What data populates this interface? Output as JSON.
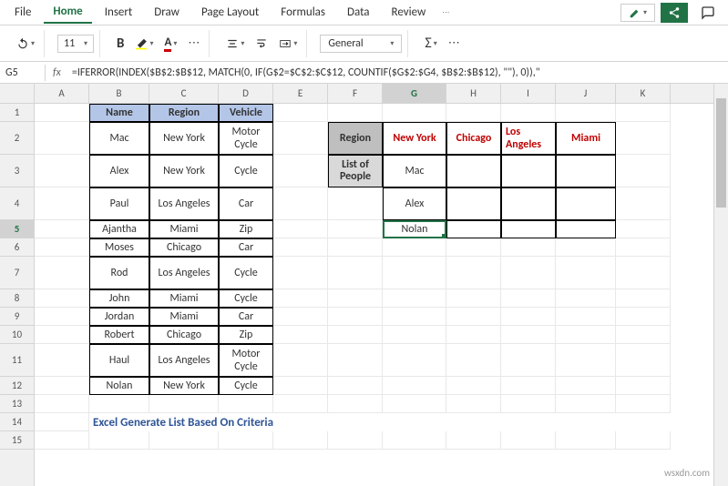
{
  "menu": {
    "file": "File",
    "home": "Home",
    "insert": "Insert",
    "draw": "Draw",
    "pageLayout": "Page Layout",
    "formulas": "Formulas",
    "data": "Data",
    "review": "Review"
  },
  "toolbar": {
    "fontSize": "11",
    "bold": "B",
    "numberFormat": "General"
  },
  "cellRef": "G5",
  "fx": "fx",
  "formula": "=IFERROR(INDEX($B$2:$B$12, MATCH(0, IF(G$2=$C$2:$C$12, COUNTIF($G$2:$G4, $B$2:$B$12), \"\"), 0)),\"",
  "cols": [
    "A",
    "B",
    "C",
    "D",
    "E",
    "F",
    "G",
    "H",
    "I",
    "J",
    "K"
  ],
  "rows": [
    "1",
    "2",
    "3",
    "4",
    "5",
    "6",
    "7",
    "8",
    "9",
    "10",
    "11",
    "12",
    "13",
    "14",
    "15"
  ],
  "table1": {
    "headers": [
      "Name",
      "Region",
      "Vehicle"
    ],
    "rows": [
      [
        "Mac",
        "New York",
        "Motor Cycle"
      ],
      [
        "Alex",
        "New York",
        "Cycle"
      ],
      [
        "Paul",
        "Los Angeles",
        "Car"
      ],
      [
        "Ajantha",
        "Miami",
        "Zip"
      ],
      [
        "Moses",
        "Chicago",
        "Car"
      ],
      [
        "Rod",
        "Los Angeles",
        "Cycle"
      ],
      [
        "John",
        "Miami",
        "Cycle"
      ],
      [
        "Jordan",
        "Miami",
        "Car"
      ],
      [
        "Robert",
        "Chicago",
        "Zip"
      ],
      [
        "Haul",
        "Los Angeles",
        "Motor Cycle"
      ],
      [
        "Nolan",
        "New York",
        "Cycle"
      ]
    ]
  },
  "table2": {
    "regionLabel": "Region",
    "listLabel": "List of People",
    "regions": [
      "New York",
      "Chicago",
      "Los Angeles",
      "Miami"
    ],
    "people": [
      "Mac",
      "Alex",
      "Nolan"
    ]
  },
  "caption": "Excel Generate List Based On Criteria",
  "watermark": "wsxdn.com"
}
